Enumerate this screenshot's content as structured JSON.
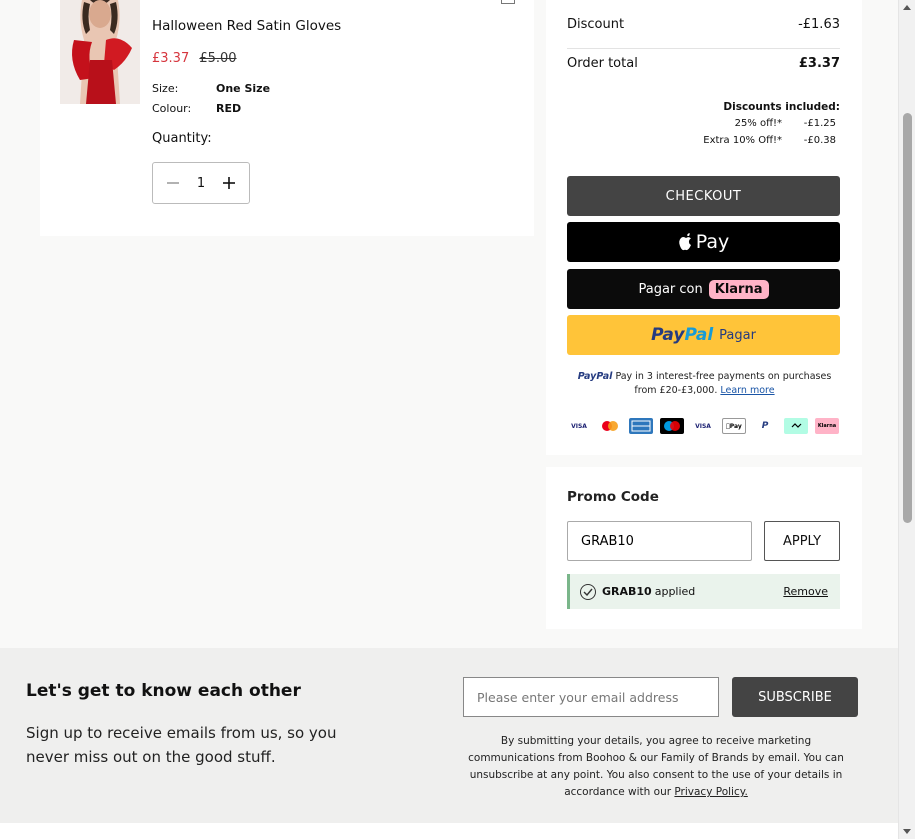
{
  "product": {
    "title": "Halloween Red Satin Gloves",
    "price_sale": "£3.37",
    "price_original": "£5.00",
    "size_label": "Size:",
    "size_value": "One Size",
    "colour_label": "Colour:",
    "colour_value": "RED",
    "quantity_label": "Quantity:",
    "quantity_value": "1"
  },
  "summary": {
    "discount_label": "Discount",
    "discount_value": "-£1.63",
    "order_total_label": "Order total",
    "order_total_value": "£3.37",
    "discounts_included_label": "Discounts included:",
    "discounts": [
      {
        "name": "25% off!*",
        "amount": "-£1.25"
      },
      {
        "name": "Extra 10% Off!*",
        "amount": "-£0.38"
      }
    ],
    "checkout_label": "CHECKOUT",
    "applepay_label": "Pay",
    "klarna_prefix": "Pagar con",
    "klarna_brand": "Klarna",
    "paypal_brand_1": "Pay",
    "paypal_brand_2": "Pal",
    "paypal_action": "Pagar",
    "paypal_info_brand": "PayPal",
    "paypal_info_text": "Pay in 3 interest-free payments on purchases from £20-£3,000.",
    "paypal_learn_more": "Learn more",
    "payment_logos": [
      "VISA",
      "Mastercard",
      "Amex",
      "Maestro",
      "Visa Electron",
      "Apple Pay",
      "PayPal",
      "Clearpay",
      "Klarna"
    ]
  },
  "promo": {
    "title": "Promo Code",
    "input_value": "GRAB10",
    "apply_label": "APPLY",
    "applied_code": "GRAB10",
    "applied_text": "applied",
    "remove_label": "Remove"
  },
  "newsletter": {
    "title": "Let's get to know each other",
    "subtitle": "Sign up to receive emails from us, so you never miss out on the good stuff.",
    "email_placeholder": "Please enter your email address",
    "subscribe_label": "SUBSCRIBE",
    "legal_text": "By submitting your details, you agree to receive marketing communications from Boohoo & our Family of Brands by email. You can unsubscribe at any point. You also consent to the use of your details in accordance with our",
    "privacy_link": "Privacy Policy."
  },
  "colors": {
    "sale_red": "#d6363e",
    "checkout_bg": "#444444",
    "paypal_yellow": "#ffc439",
    "klarna_pink": "#ffb3c7",
    "applied_green": "#eaf3ec"
  }
}
